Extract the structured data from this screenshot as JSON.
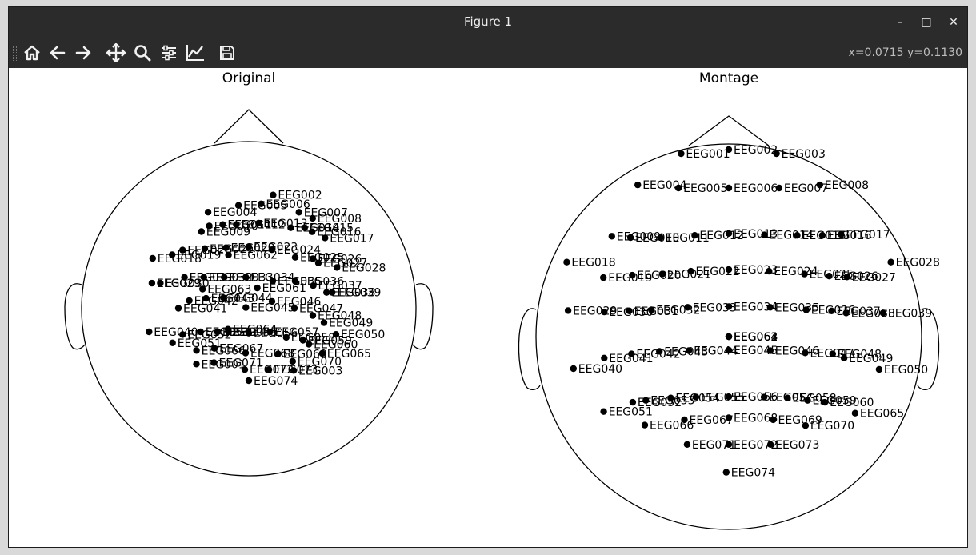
{
  "window": {
    "title": "Figure 1",
    "buttons": [
      "minimize",
      "maximize",
      "close"
    ],
    "minimize_glyph": "–",
    "maximize_glyph": "□",
    "close_glyph": "✕"
  },
  "toolbar": {
    "tools": [
      "home-icon",
      "back-icon",
      "forward-icon",
      "pan-icon",
      "zoom-icon",
      "configure-subplots-icon",
      "edit-axis-icon",
      "save-icon"
    ],
    "coordinates": "x=0.0715 y=0.1130"
  },
  "chart_data": [
    {
      "type": "scatter",
      "title": "Original",
      "points": [
        {
          "label": "EEG002",
          "x": 0.304,
          "y": 0.223
        },
        {
          "label": "EEG005",
          "x": -0.129,
          "y": 0.093
        },
        {
          "label": "EEG006",
          "x": 0.155,
          "y": 0.112
        },
        {
          "label": "EEG004",
          "x": -0.509,
          "y": 0.008
        },
        {
          "label": "EEG007",
          "x": 0.627,
          "y": 0.007
        },
        {
          "label": "EEG008",
          "x": 0.798,
          "y": -0.069
        },
        {
          "label": "EEG009",
          "x": -0.592,
          "y": -0.235
        },
        {
          "label": "EEG010",
          "x": -0.494,
          "y": -0.164
        },
        {
          "label": "EEG011",
          "x": -0.326,
          "y": -0.147
        },
        {
          "label": "EEG012",
          "x": -0.156,
          "y": -0.147
        },
        {
          "label": "EEG013",
          "x": 0.123,
          "y": -0.13
        },
        {
          "label": "EEG014",
          "x": 0.524,
          "y": -0.187
        },
        {
          "label": "EEG015",
          "x": 0.698,
          "y": -0.187
        },
        {
          "label": "EEG016",
          "x": 0.791,
          "y": -0.237
        },
        {
          "label": "EEG017",
          "x": 0.953,
          "y": -0.314
        },
        {
          "label": "EEG018",
          "x": -1.202,
          "y": -0.57
        },
        {
          "label": "EEG019",
          "x": -0.958,
          "y": -0.524
        },
        {
          "label": "EEG020",
          "x": -0.828,
          "y": -0.466
        },
        {
          "label": "EEG021",
          "x": -0.55,
          "y": -0.448
        },
        {
          "label": "EEG022",
          "x": -0.285,
          "y": -0.437
        },
        {
          "label": "EEG023",
          "x": 0.0,
          "y": -0.423
        },
        {
          "label": "EEG024",
          "x": 0.288,
          "y": -0.462
        },
        {
          "label": "EEG025",
          "x": 0.58,
          "y": -0.557
        },
        {
          "label": "EEG026",
          "x": 0.802,
          "y": -0.574
        },
        {
          "label": "EEG027",
          "x": 0.87,
          "y": -0.627
        },
        {
          "label": "EEG028",
          "x": 1.102,
          "y": -0.684
        },
        {
          "label": "EEG029",
          "x": -1.211,
          "y": -0.881
        },
        {
          "label": "EEG030",
          "x": -1.106,
          "y": -0.881
        },
        {
          "label": "EEG031",
          "x": -0.804,
          "y": -0.807
        },
        {
          "label": "EEG032",
          "x": -0.562,
          "y": -0.807
        },
        {
          "label": "EEG033",
          "x": -0.307,
          "y": -0.807
        },
        {
          "label": "EEG034",
          "x": -0.037,
          "y": -0.807
        },
        {
          "label": "EEG035",
          "x": 0.299,
          "y": -0.855
        },
        {
          "label": "EEG036",
          "x": 0.579,
          "y": -0.855
        },
        {
          "label": "EEG037",
          "x": 0.805,
          "y": -0.912
        },
        {
          "label": "EEG038",
          "x": 0.972,
          "y": -0.997
        },
        {
          "label": "EEG039",
          "x": 1.042,
          "y": -0.997
        },
        {
          "label": "EEG040",
          "x": -1.247,
          "y": -1.49
        },
        {
          "label": "EEG041",
          "x": -0.88,
          "y": -1.195
        },
        {
          "label": "EEG042",
          "x": -0.744,
          "y": -1.1
        },
        {
          "label": "EEG043",
          "x": -0.534,
          "y": -1.071
        },
        {
          "label": "EEG044",
          "x": -0.316,
          "y": -1.064
        },
        {
          "label": "EEG045",
          "x": -0.037,
          "y": -1.186
        },
        {
          "label": "EEG046",
          "x": 0.29,
          "y": -1.109
        },
        {
          "label": "EEG047",
          "x": 0.57,
          "y": -1.195
        },
        {
          "label": "EEG048",
          "x": 0.8,
          "y": -1.286
        },
        {
          "label": "EEG049",
          "x": 0.94,
          "y": -1.375
        },
        {
          "label": "EEG050",
          "x": 1.09,
          "y": -1.522
        },
        {
          "label": "EEG051",
          "x": -0.953,
          "y": -1.628
        },
        {
          "label": "EEG052",
          "x": -0.827,
          "y": -1.524
        },
        {
          "label": "EEG053",
          "x": -0.603,
          "y": -1.49
        },
        {
          "label": "EEG054",
          "x": -0.391,
          "y": -1.49
        },
        {
          "label": "EEG055",
          "x": -0.254,
          "y": -1.49
        },
        {
          "label": "EEG056",
          "x": 0.0,
          "y": -1.507
        },
        {
          "label": "EEG057",
          "x": 0.264,
          "y": -1.49
        },
        {
          "label": "EEG058",
          "x": 0.468,
          "y": -1.559
        },
        {
          "label": "EEG059",
          "x": 0.677,
          "y": -1.595
        },
        {
          "label": "EEG060",
          "x": 0.751,
          "y": -1.645
        },
        {
          "label": "EEG061",
          "x": 0.106,
          "y": -0.941
        },
        {
          "label": "EEG062",
          "x": -0.254,
          "y": -0.527
        },
        {
          "label": "EEG063",
          "x": -0.578,
          "y": -0.955
        },
        {
          "label": "EEG064",
          "x": -0.26,
          "y": -1.457
        },
        {
          "label": "EEG065",
          "x": 0.918,
          "y": -1.76
        },
        {
          "label": "EEG066",
          "x": -0.654,
          "y": -1.723
        },
        {
          "label": "EEG067",
          "x": -0.429,
          "y": -1.697
        },
        {
          "label": "EEG068",
          "x": -0.04,
          "y": -1.755
        },
        {
          "label": "EEG069",
          "x": 0.366,
          "y": -1.766
        },
        {
          "label": "EEG070",
          "x": 0.548,
          "y": -1.859
        },
        {
          "label": "EEG071",
          "x": -0.435,
          "y": -1.876
        },
        {
          "label": "EEG072",
          "x": -0.05,
          "y": -1.962
        },
        {
          "label": "EEG073",
          "x": 0.251,
          "y": -1.962
        },
        {
          "label": "EEG074",
          "x": 0.0,
          "y": -2.1
        },
        {
          "label": "EEG001",
          "x": -0.655,
          "y": -1.893
        },
        {
          "label": "EEG003",
          "x": 0.561,
          "y": -1.973
        }
      ]
    },
    {
      "type": "scatter",
      "title": "Montage",
      "points": [
        {
          "label": "EEG001",
          "x": -0.276,
          "y": 1.06
        },
        {
          "label": "EEG002",
          "x": 0.0,
          "y": 1.084
        },
        {
          "label": "EEG003",
          "x": 0.276,
          "y": 1.06
        },
        {
          "label": "EEG004",
          "x": -0.527,
          "y": 0.879
        },
        {
          "label": "EEG005",
          "x": -0.291,
          "y": 0.861
        },
        {
          "label": "EEG006",
          "x": 0.0,
          "y": 0.861
        },
        {
          "label": "EEG007",
          "x": 0.291,
          "y": 0.861
        },
        {
          "label": "EEG008",
          "x": 0.527,
          "y": 0.879
        },
        {
          "label": "EEG009",
          "x": -0.677,
          "y": 0.582
        },
        {
          "label": "EEG010",
          "x": -0.569,
          "y": 0.574
        },
        {
          "label": "EEG011",
          "x": -0.396,
          "y": 0.574
        },
        {
          "label": "EEG012",
          "x": -0.197,
          "y": 0.587
        },
        {
          "label": "EEG013",
          "x": 0.0,
          "y": 0.598
        },
        {
          "label": "EEG014",
          "x": 0.206,
          "y": 0.59
        },
        {
          "label": "EEG015",
          "x": 0.396,
          "y": 0.587
        },
        {
          "label": "EEG016",
          "x": 0.541,
          "y": 0.587
        },
        {
          "label": "EEG017",
          "x": 0.65,
          "y": 0.592
        },
        {
          "label": "EEG018",
          "x": -0.938,
          "y": 0.432
        },
        {
          "label": "EEG019",
          "x": -0.726,
          "y": 0.342
        },
        {
          "label": "EEG020",
          "x": -0.559,
          "y": 0.356
        },
        {
          "label": "EEG021",
          "x": -0.385,
          "y": 0.363
        },
        {
          "label": "EEG022",
          "x": -0.22,
          "y": 0.379
        },
        {
          "label": "EEG023",
          "x": 0.0,
          "y": 0.389
        },
        {
          "label": "EEG024",
          "x": 0.233,
          "y": 0.379
        },
        {
          "label": "EEG025",
          "x": 0.438,
          "y": 0.363
        },
        {
          "label": "EEG026",
          "x": 0.581,
          "y": 0.351
        },
        {
          "label": "EEG027",
          "x": 0.684,
          "y": 0.346
        },
        {
          "label": "EEG028",
          "x": 0.938,
          "y": 0.432
        },
        {
          "label": "EEG029",
          "x": -0.93,
          "y": 0.151
        },
        {
          "label": "EEG030",
          "x": -0.721,
          "y": 0.143
        },
        {
          "label": "EEG031",
          "x": -0.576,
          "y": 0.149
        },
        {
          "label": "EEG032",
          "x": -0.448,
          "y": 0.155
        },
        {
          "label": "EEG033",
          "x": -0.238,
          "y": 0.17
        },
        {
          "label": "EEG034",
          "x": 0.0,
          "y": 0.174
        },
        {
          "label": "EEG035",
          "x": 0.24,
          "y": 0.17
        },
        {
          "label": "EEG036",
          "x": 0.448,
          "y": 0.155
        },
        {
          "label": "EEG037",
          "x": 0.595,
          "y": 0.149
        },
        {
          "label": "EEG038",
          "x": 0.679,
          "y": 0.137
        },
        {
          "label": "EEG039",
          "x": 0.893,
          "y": 0.137
        },
        {
          "label": "EEG040",
          "x": -0.899,
          "y": -0.185
        },
        {
          "label": "EEG041",
          "x": -0.721,
          "y": -0.124
        },
        {
          "label": "EEG042",
          "x": -0.563,
          "y": -0.1
        },
        {
          "label": "EEG043",
          "x": -0.402,
          "y": -0.085
        },
        {
          "label": "EEG044",
          "x": -0.231,
          "y": -0.081
        },
        {
          "label": "EEG045",
          "x": 0.0,
          "y": -0.078
        },
        {
          "label": "EEG046",
          "x": 0.24,
          "y": -0.081
        },
        {
          "label": "EEG047",
          "x": 0.442,
          "y": -0.094
        },
        {
          "label": "EEG048",
          "x": 0.601,
          "y": -0.1
        },
        {
          "label": "EEG049",
          "x": 0.667,
          "y": -0.124
        },
        {
          "label": "EEG050",
          "x": 0.87,
          "y": -0.19
        },
        {
          "label": "EEG051",
          "x": -0.724,
          "y": -0.434
        },
        {
          "label": "EEG052",
          "x": -0.556,
          "y": -0.38
        },
        {
          "label": "EEG053",
          "x": -0.48,
          "y": -0.369
        },
        {
          "label": "EEG054",
          "x": -0.336,
          "y": -0.355
        },
        {
          "label": "EEG055",
          "x": -0.19,
          "y": -0.35
        },
        {
          "label": "EEG056",
          "x": 0.0,
          "y": -0.348
        },
        {
          "label": "EEG057",
          "x": 0.204,
          "y": -0.35
        },
        {
          "label": "EEG058",
          "x": 0.34,
          "y": -0.355
        },
        {
          "label": "EEG059",
          "x": 0.456,
          "y": -0.369
        },
        {
          "label": "EEG060",
          "x": 0.556,
          "y": -0.38
        },
        {
          "label": "EEG061",
          "x": 0.0,
          "y": 0.0
        },
        {
          "label": "EEG062",
          "x": 0.0,
          "y": 0.0
        },
        {
          "label": "EEG063",
          "x": 0.0,
          "y": 0.0
        },
        {
          "label": "EEG064",
          "x": 0.0,
          "y": 0.0
        },
        {
          "label": "EEG065",
          "x": 0.731,
          "y": -0.443
        },
        {
          "label": "EEG066",
          "x": -0.486,
          "y": -0.512
        },
        {
          "label": "EEG067",
          "x": -0.257,
          "y": -0.481
        },
        {
          "label": "EEG068",
          "x": 0.0,
          "y": -0.47
        },
        {
          "label": "EEG069",
          "x": 0.257,
          "y": -0.481
        },
        {
          "label": "EEG070",
          "x": 0.444,
          "y": -0.515
        },
        {
          "label": "EEG071",
          "x": -0.241,
          "y": -0.624
        },
        {
          "label": "EEG072",
          "x": 0.0,
          "y": -0.624
        },
        {
          "label": "EEG073",
          "x": 0.241,
          "y": -0.624
        },
        {
          "label": "EEG074",
          "x": -0.015,
          "y": -0.785
        }
      ]
    }
  ]
}
